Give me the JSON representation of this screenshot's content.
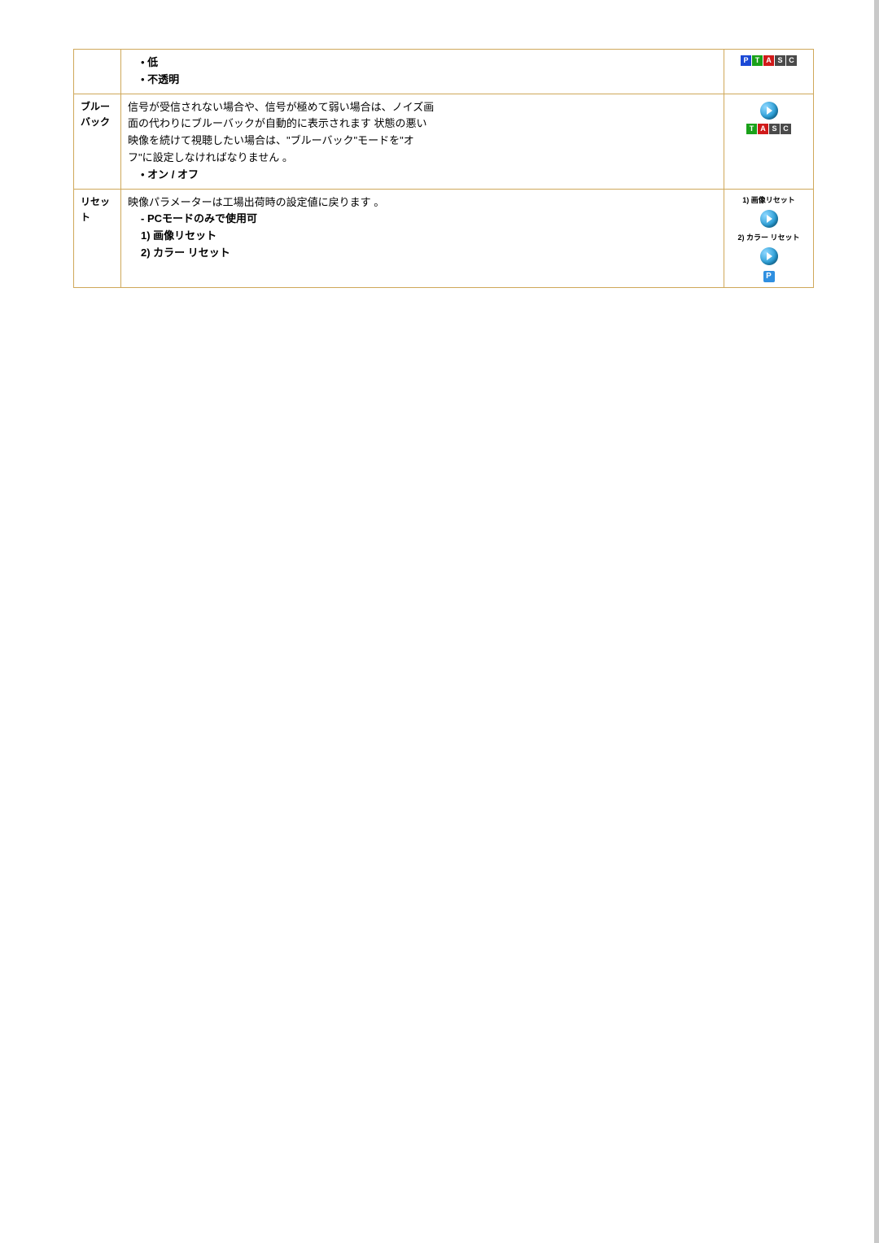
{
  "rows": {
    "r0": {
      "bullets": {
        "b1": "低",
        "b2": "不透明"
      },
      "icon": {
        "p": "P",
        "t": "T",
        "a": "A",
        "s": "S",
        "c": "C"
      }
    },
    "r1": {
      "label_line1": "ブルー",
      "label_line2": "バック",
      "desc_l1": "信号が受信されない場合や、信号が極めて弱い場合は、ノイズ画",
      "desc_l2": "面の代わりにブルーバックが自動的に表示されます 状態の悪い",
      "desc_l3": "映像を続けて視聴したい場合は、\"ブルーバック\"モードを\"オ",
      "desc_l4": "フ\"に設定しなければなりません 。",
      "bullet": "オン / オフ",
      "icon": {
        "t": "T",
        "a": "A",
        "s": "S",
        "c": "C"
      }
    },
    "r2": {
      "label": "リセット",
      "desc": "映像パラメーターは工場出荷時の設定値に戻ります 。",
      "sub1": "- PCモードのみで使用可",
      "sub2": "1) 画像リセット",
      "sub3": "2) カラー リセット",
      "cap1": "1) 画像リセット",
      "cap2": "2) カラー リセット",
      "p": "P"
    }
  }
}
